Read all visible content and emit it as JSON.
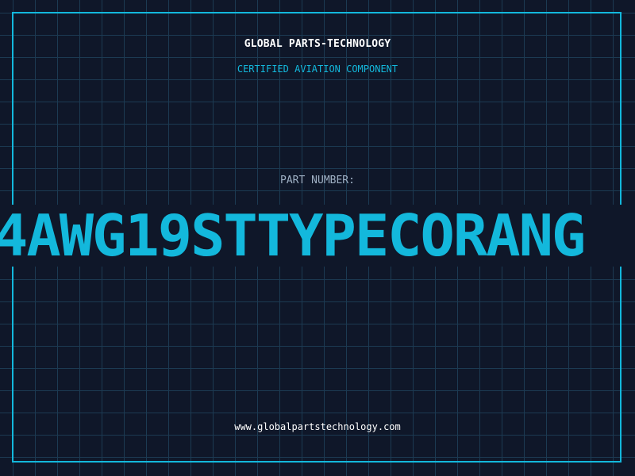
{
  "header": {
    "company": "GLOBAL PARTS-TECHNOLOGY",
    "subtitle": "CERTIFIED AVIATION COMPONENT"
  },
  "part": {
    "label": "PART NUMBER:",
    "value": "4AWG19STTYPECORANG"
  },
  "footer": {
    "website": "www.globalpartstechnology.com"
  },
  "colors": {
    "background": "#0f1729",
    "grid": "#1c3a52",
    "accent": "#13b8dc",
    "text": "#ffffff",
    "muted": "#9fb0c4"
  }
}
